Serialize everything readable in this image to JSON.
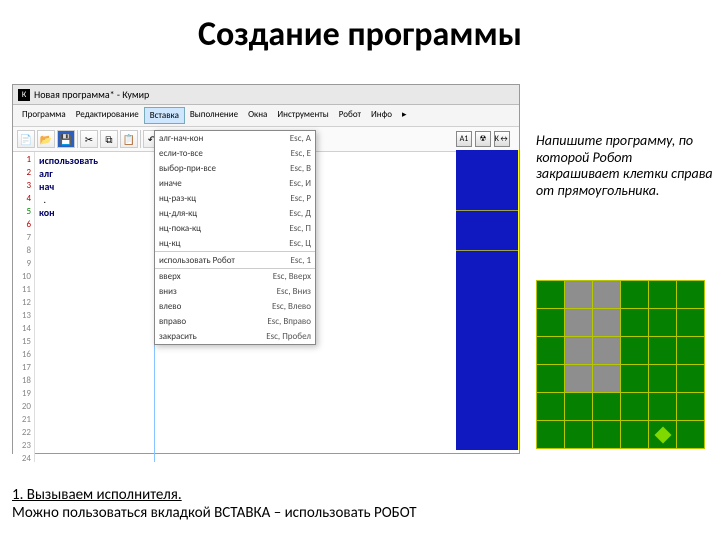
{
  "slide": {
    "title": "Создание программы"
  },
  "app": {
    "window_title": "Новая программа* - Кумир",
    "app_icon": "К",
    "menu": [
      "Программа",
      "Редактирование",
      "Вставка",
      "Выполнение",
      "Окна",
      "Инструменты",
      "Робот",
      "Инфо"
    ],
    "active_menu": "Вставка",
    "toolbar_icons": [
      "new",
      "open",
      "save",
      "sep",
      "cut",
      "copy",
      "paste",
      "sep",
      "undo",
      "redo",
      "10",
      "run",
      "step"
    ],
    "right_icons": [
      "A1",
      "☢",
      "K↔"
    ]
  },
  "code": {
    "lines": [
      "использовать",
      "алг",
      "нач",
      "  .",
      "кон",
      "",
      "",
      "",
      "",
      "",
      "",
      "",
      "",
      "",
      "",
      "",
      "",
      "",
      "",
      "",
      "",
      "",
      "",
      ""
    ]
  },
  "dropdown": {
    "items": [
      {
        "label": "алг-нач-кон",
        "key": "Esc, A"
      },
      {
        "label": "если-то-все",
        "key": "Esc, Е"
      },
      {
        "label": "выбор-при-все",
        "key": "Esc, В"
      },
      {
        "label": "иначе",
        "key": "Esc, И"
      },
      {
        "label": "нц-раз-кц",
        "key": "Esc, Р"
      },
      {
        "label": "нц-для-кц",
        "key": "Esc, Д"
      },
      {
        "label": "нц-пока-кц",
        "key": "Esc, П"
      },
      {
        "label": "нц-кц",
        "key": "Esc, Ц"
      }
    ],
    "items2": [
      {
        "label": "использовать Робот",
        "key": "Esc, 1"
      }
    ],
    "items3": [
      {
        "label": "вверх",
        "key": "Esc, Вверх"
      },
      {
        "label": "вниз",
        "key": "Esc, Вниз"
      },
      {
        "label": "влево",
        "key": "Esc, Влево"
      },
      {
        "label": "вправо",
        "key": "Esc, Вправо"
      },
      {
        "label": "закрасить",
        "key": "Esc, Пробел"
      }
    ]
  },
  "task_text": "Напишите программу, по которой Робот закрашивает клетки справа от прямоугольника.",
  "grid_layout": [
    [
      "g",
      "x",
      "x",
      "g",
      "g",
      "g"
    ],
    [
      "g",
      "x",
      "x",
      "g",
      "g",
      "g"
    ],
    [
      "g",
      "x",
      "x",
      "g",
      "g",
      "g"
    ],
    [
      "g",
      "x",
      "x",
      "g",
      "g",
      "g"
    ],
    [
      "g",
      "g",
      "g",
      "g",
      "g",
      "g"
    ],
    [
      "g",
      "g",
      "g",
      "g",
      "d",
      "g"
    ]
  ],
  "footer": {
    "line1": "1. Вызываем исполнителя.",
    "line2": "Можно пользоваться вкладкой ВСТАВКА – использовать РОБОТ"
  }
}
